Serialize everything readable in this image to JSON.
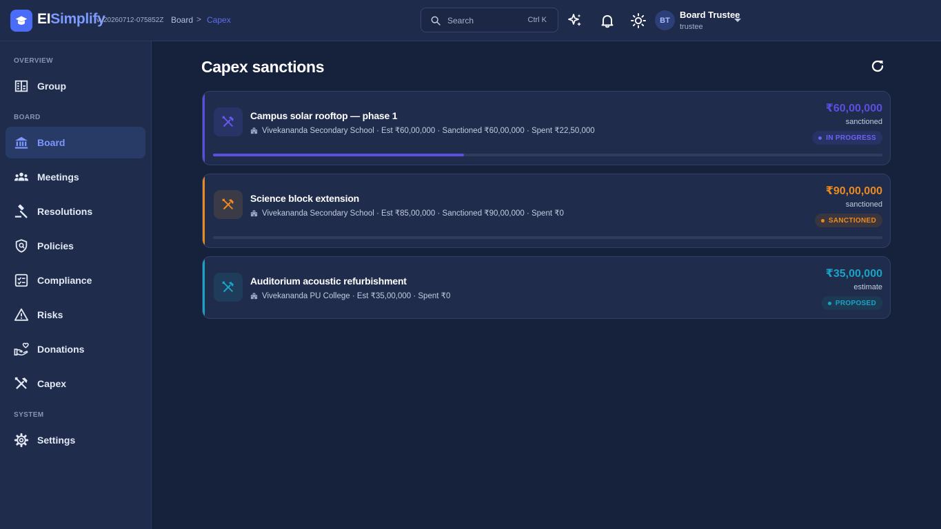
{
  "app": {
    "brand_part1": "EI",
    "brand_part2": "Simplify",
    "version": "vv20260712-075852Z"
  },
  "breadcrumb": {
    "items": [
      "Board",
      "Capex"
    ],
    "separator": ">"
  },
  "search": {
    "placeholder": "Search",
    "shortcut": "Ctrl K"
  },
  "user": {
    "initials": "BT",
    "name": "Board Trustee",
    "role": "trustee"
  },
  "sidebar": {
    "sections": [
      {
        "label": "OVERVIEW"
      },
      {
        "label": "BOARD"
      },
      {
        "label": "SYSTEM"
      }
    ],
    "items": [
      {
        "label": "Group",
        "icon": "building-icon"
      },
      {
        "label": "Board",
        "icon": "institution-icon",
        "active": true
      },
      {
        "label": "Meetings",
        "icon": "people-group-icon"
      },
      {
        "label": "Resolutions",
        "icon": "gavel-icon"
      },
      {
        "label": "Policies",
        "icon": "shield-icon"
      },
      {
        "label": "Compliance",
        "icon": "checklist-icon"
      },
      {
        "label": "Risks",
        "icon": "warning-icon"
      },
      {
        "label": "Donations",
        "icon": "donation-hand-icon"
      },
      {
        "label": "Capex",
        "icon": "tools-icon"
      },
      {
        "label": "Settings",
        "icon": "gear-icon"
      }
    ]
  },
  "main": {
    "title": "Capex sanctions",
    "cards": [
      {
        "title": "Campus solar rooftop — phase 1",
        "meta": "Vivekananda Secondary School · Est ₹60,00,000 · Sanctioned ₹60,00,000 · Spent ₹22,50,000",
        "amount": "₹60,00,000",
        "amount_label": "sanctioned",
        "status": "IN PROGRESS",
        "progress": 0.375,
        "color": "#5b4ee0"
      },
      {
        "title": "Science block extension",
        "meta": "Vivekananda Secondary School · Est ₹85,00,000 · Sanctioned ₹90,00,000 · Spent ₹0",
        "amount": "₹90,00,000",
        "amount_label": "sanctioned",
        "status": "SANCTIONED",
        "progress": 0,
        "color": "#ec8a1e"
      },
      {
        "title": "Auditorium acoustic refurbishment",
        "meta": "Vivekananda PU College · Est ₹35,00,000 · Spent ₹0",
        "amount": "₹35,00,000",
        "amount_label": "estimate",
        "status": "PROPOSED",
        "color": "#1aa3c6"
      }
    ]
  }
}
